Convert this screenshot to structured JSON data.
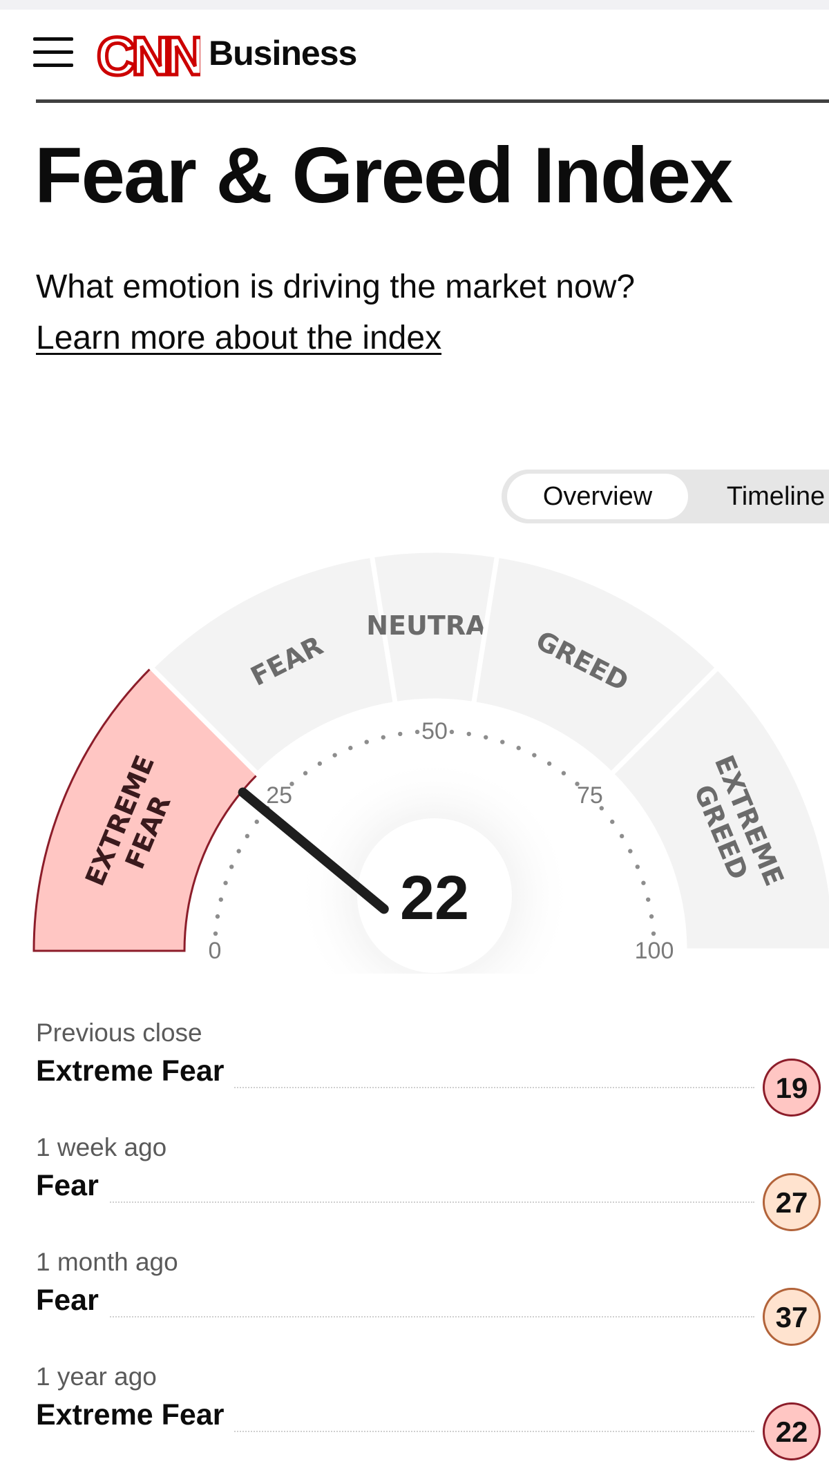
{
  "header": {
    "menu_icon": "hamburger-icon",
    "logo_text": "CNN",
    "section": "Business"
  },
  "page": {
    "title": "Fear & Greed Index",
    "subtitle": "What emotion is driving the market now?",
    "learn_link": "Learn more about the index"
  },
  "view_toggle": {
    "options": [
      "Overview",
      "Timeline"
    ],
    "selected": "Overview"
  },
  "gauge": {
    "value": "22",
    "value_number": 22,
    "range": [
      0,
      100
    ],
    "tick_labels": [
      "0",
      "25",
      "50",
      "75",
      "100"
    ],
    "zones": [
      {
        "line1": "EXTREME",
        "line2": "FEAR",
        "from": 0,
        "to": 25,
        "active": true
      },
      {
        "line1": "FEAR",
        "line2": "",
        "from": 25,
        "to": 45,
        "active": false
      },
      {
        "line1": "NEUTRAL",
        "line2": "",
        "from": 45,
        "to": 55,
        "active": false
      },
      {
        "line1": "GREED",
        "line2": "",
        "from": 55,
        "to": 75,
        "active": false
      },
      {
        "line1": "EXTREME",
        "line2": "GREED",
        "from": 75,
        "to": 100,
        "active": false
      }
    ],
    "colors": {
      "active_fill": "#ffc6c3",
      "active_stroke": "#8c1d2a",
      "zone_fill": "#f3f3f3",
      "needle": "#1e1e1e",
      "label": "#6b6b6b"
    }
  },
  "history": [
    {
      "when": "Previous close",
      "label": "Extreme Fear",
      "value": "19",
      "level": "extreme-fear"
    },
    {
      "when": "1 week ago",
      "label": "Fear",
      "value": "27",
      "level": "fear"
    },
    {
      "when": "1 month ago",
      "label": "Fear",
      "value": "37",
      "level": "fear"
    },
    {
      "when": "1 year ago",
      "label": "Extreme Fear",
      "value": "22",
      "level": "extreme-fear"
    }
  ]
}
